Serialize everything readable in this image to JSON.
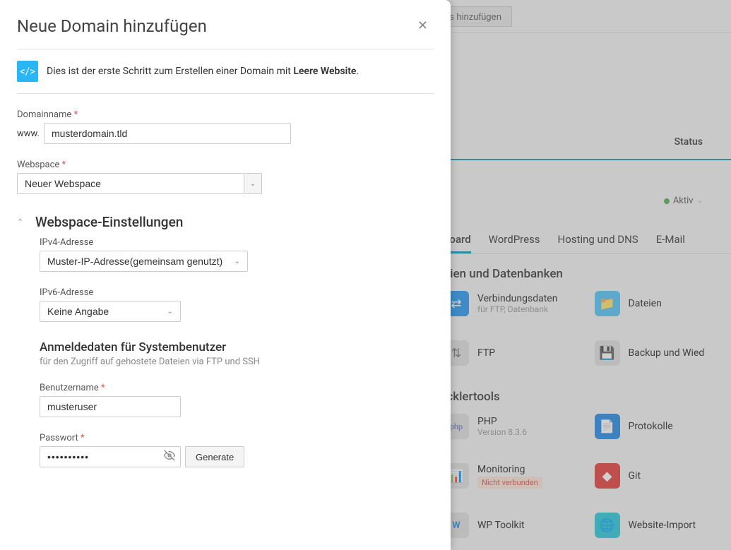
{
  "background": {
    "topbar_button": "n-Alias hinzufügen",
    "status_label": "Status",
    "active_label": "Aktiv",
    "tabs": [
      "board",
      "WordPress",
      "Hosting und DNS",
      "E-Mail"
    ],
    "section1_title": "eien und Datenbanken",
    "row1": [
      {
        "title": "Verbindungsdaten",
        "sub": "für FTP, Datenbank"
      },
      {
        "title": "Dateien"
      }
    ],
    "row2": [
      {
        "title": "FTP"
      },
      {
        "title": "Backup und Wied"
      }
    ],
    "section2_title": "icklertools",
    "row3": [
      {
        "title": "PHP",
        "sub": "Version 8.3.6"
      },
      {
        "title": "Protokolle"
      }
    ],
    "row4": [
      {
        "title": "Monitoring",
        "badge": "Nicht verbunden"
      },
      {
        "title": "Git"
      }
    ],
    "row5": [
      {
        "title": "WP Toolkit"
      },
      {
        "title": "Website-Import"
      }
    ]
  },
  "modal": {
    "title": "Neue Domain hinzufügen",
    "info_prefix": "Dies ist der erste Schritt zum Erstellen einer Domain mit ",
    "info_bold": "Leere Website",
    "info_suffix": ".",
    "domain_label": "Domainname",
    "domain_prefix": "www.",
    "domain_value": "musterdomain.tld",
    "webspace_label": "Webspace",
    "webspace_value": "Neuer Webspace",
    "collapse_title": "Webspace-Einstellungen",
    "ipv4_label": "IPv4-Adresse",
    "ipv4_value": "Muster-IP-Adresse(gemeinsam genutzt)",
    "ipv6_label": "IPv6-Adresse",
    "ipv6_value": "Keine Angabe",
    "sysuser_heading": "Anmeldedaten für Systembenutzer",
    "sysuser_desc": "für den Zugriff auf gehostete Dateien via FTP und SSH",
    "username_label": "Benutzername",
    "username_value": "musteruser",
    "password_label": "Passwort",
    "password_value": "••••••••••",
    "generate_label": "Generate"
  }
}
